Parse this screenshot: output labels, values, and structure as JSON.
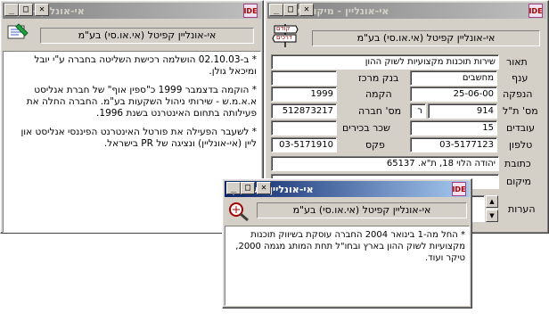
{
  "win_left": {
    "title": "אי-אונליין - רקע",
    "company_name": "אי-אונליין קפיטל (אי.או.סי) בע\"מ",
    "paragraphs": [
      "* ב-02.10.03 הושלמה רכישת השליטה בחברה ע\"י יובל ומיכאל גולן.",
      "* הוקמה בדצמבר 1999 כ\"ספין אוף\" של חברת אנליסט א.א.מ.ש - שירותי ניהול השקעות בע\"מ. החברה החלה את פעילותה בתחום האינטרנט בשנת 1996.",
      "* לשעבר הפעילה את פורטל האינטרנט הפיננסי אנליסט און ליין (אי-אונליין) ונציגה של PR בישראל."
    ]
  },
  "win_main": {
    "title": "אי-אונליין - מיקום ושונות",
    "nav_up": "קודם",
    "nav_down": "דרכים",
    "company_name": "אי-אונליין קפיטל (אי.או.סי) בע\"מ",
    "labels": {
      "description": "תאור",
      "branch": "ענף",
      "central_bank": "בנק מרכז",
      "established": "הקמה",
      "issue": "הנפקה",
      "tase_num": "מס' ת\"ל",
      "company_num": "מס' חברה",
      "employees": "עובדים",
      "exec_pay": "שכר בכירים",
      "phone": "טלפון",
      "fax": "פקס",
      "address": "כתובת",
      "location": "מיקום",
      "notes": "הערות"
    },
    "values": {
      "description": "שירות תוכנות מקצועיות לשוק ההון",
      "branch": "מחשבים",
      "central_bank": "",
      "established": "1999",
      "issue": "25-06-00",
      "tase_num": "914",
      "tase_letter": "ר",
      "company_num": "512873217",
      "employees": "15",
      "exec_pay": "",
      "phone": "03-5177123",
      "fax": "03-5171910",
      "address": "יהודה הלוי 18, ת\"א. 65137",
      "location": "",
      "notes": ""
    }
  },
  "win_occupation": {
    "title": "אי-אונליין - עיסוק",
    "company_name": "אי-אונליין קפיטל (אי.או.סי) בע\"מ",
    "text": "* החל מה-1 בינואר 2004 החברה עוסקת בשיווק תוכנות מקצועיות לשוק ההון בארץ ובחו\"ל תחת המותג מגמה 2000, טיקר ועוד."
  },
  "buttons": {
    "minimize": "_",
    "maximize": "□",
    "close": "✕"
  },
  "colors": {
    "title_active": "#0a246a",
    "title_inactive": "#808080",
    "face": "#d4d0c8"
  }
}
